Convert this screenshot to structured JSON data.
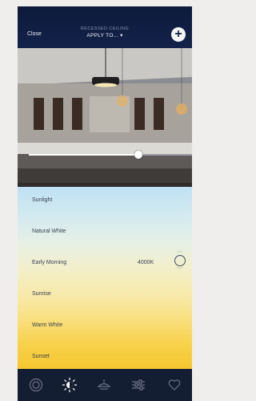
{
  "header": {
    "close_label": "Close",
    "subtitle": "RECESSED CEILING",
    "apply_label": "APPLY TO... ▾",
    "add_icon": "plus-icon"
  },
  "brightness": {
    "level": 0.67
  },
  "presets": [
    {
      "label": "Sunlight"
    },
    {
      "label": "Natural White"
    },
    {
      "label": "Early Morning"
    },
    {
      "label": "Sunrise"
    },
    {
      "label": "Warm White"
    },
    {
      "label": "Sunset"
    }
  ],
  "selected_preset": {
    "cct_label": "4000K",
    "up_icon": "chevron-up-icon",
    "down_icon": "chevron-down-icon"
  },
  "tabs": [
    {
      "icon": "circle-target-icon",
      "active": false
    },
    {
      "icon": "sun-dimmer-icon",
      "active": true
    },
    {
      "icon": "lamp-icon",
      "active": false
    },
    {
      "icon": "sliders-icon",
      "active": false
    },
    {
      "icon": "heart-icon",
      "active": false
    }
  ],
  "colors": {
    "header": "#13224a",
    "tabbar": "#141e33",
    "gradient_top": "#bfe1f2",
    "gradient_bottom": "#f4c62f"
  }
}
